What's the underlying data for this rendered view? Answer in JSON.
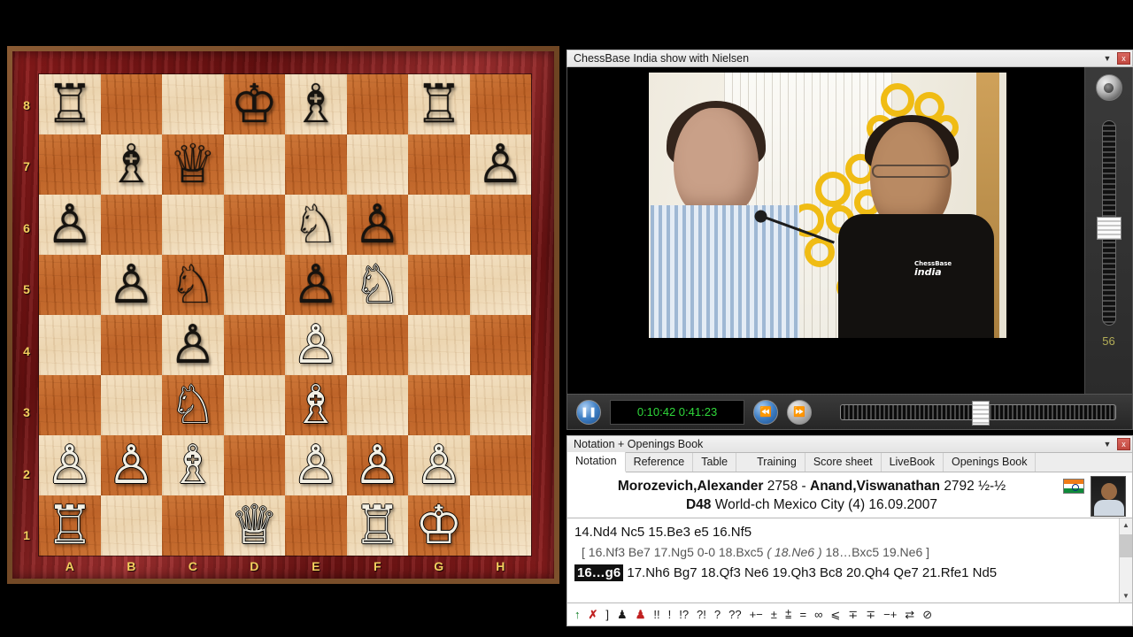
{
  "board": {
    "ranks": [
      "8",
      "7",
      "6",
      "5",
      "4",
      "3",
      "2",
      "1"
    ],
    "files": [
      "A",
      "B",
      "C",
      "D",
      "E",
      "F",
      "G",
      "H"
    ],
    "position": [
      [
        "r",
        "",
        "",
        "k",
        "b",
        "",
        "r",
        ""
      ],
      [
        "",
        "b",
        "q",
        "",
        "",
        "",
        "",
        "p"
      ],
      [
        "p",
        "",
        "",
        "",
        "n",
        "p",
        "",
        ""
      ],
      [
        "",
        "p",
        "n",
        "",
        "p",
        "N",
        "",
        ""
      ],
      [
        "",
        "",
        "p",
        "",
        "P",
        "",
        "",
        ""
      ],
      [
        "",
        "",
        "N",
        "",
        "B",
        "",
        "",
        ""
      ],
      [
        "P",
        "P",
        "B",
        "",
        "P",
        "P",
        "P",
        ""
      ],
      [
        "R",
        "",
        "",
        "Q",
        "",
        "R",
        "K",
        ""
      ]
    ]
  },
  "video_window": {
    "title": "ChessBase India show with Nielsen",
    "minimize_icon": "chevron-down-icon",
    "close_label": "x",
    "volume": {
      "value": "56",
      "speaker_icon": "speaker-icon"
    },
    "transport": {
      "pause_icon": "pause-icon",
      "timecode": "0:10:42 0:41:23",
      "rewind_icon": "rewind-icon",
      "forward_icon": "fast-forward-icon"
    }
  },
  "notation_window": {
    "title": "Notation + Openings Book",
    "minimize_icon": "chevron-down-icon",
    "close_label": "x",
    "tabs": [
      {
        "label": "Notation",
        "active": true
      },
      {
        "label": "Reference",
        "active": false
      },
      {
        "label": "Table",
        "active": false
      },
      {
        "label": "Training",
        "active": false
      },
      {
        "label": "Score sheet",
        "active": false
      },
      {
        "label": "LiveBook",
        "active": false
      },
      {
        "label": "Openings Book",
        "active": false
      }
    ],
    "game_header": {
      "white_name": "Morozevich,Alexander",
      "white_elo": "2758",
      "dash": "-",
      "black_name": "Anand,Viswanathan",
      "black_elo": "2792",
      "result": "½-½",
      "eco": "D48",
      "event": "World-ch Mexico City (4) 16.09.2007"
    },
    "moves": {
      "line1": "14.Nd4  Nc5  15.Be3  e5  16.Nf5",
      "variation_open": "[ 16.Nf3  Be7  17.Ng5  0-0  18.Bxc5 ",
      "variation_sub": "( 18.Ne6 )",
      "variation_close": " 18…Bxc5  19.Ne6 ]",
      "current_move": "16…g6",
      "line3_rest": "17.Nh6  Bg7  18.Qf3  Ne6  19.Qh3  Bc8  20.Qh4  Qe7  21.Rfe1  Nd5"
    },
    "scrollbar": {
      "up_icon": "scroll-up-icon",
      "down_icon": "scroll-down-icon"
    },
    "annotation_symbols": [
      "↑",
      "✗",
      "]",
      "♟",
      "♟",
      "!!",
      "!",
      "!?",
      "?!",
      "?",
      "??",
      "+−",
      "±",
      "⩲",
      "=",
      "∞",
      "⩽",
      "∓",
      "∓",
      "−+",
      "⇄",
      "⊘"
    ]
  }
}
